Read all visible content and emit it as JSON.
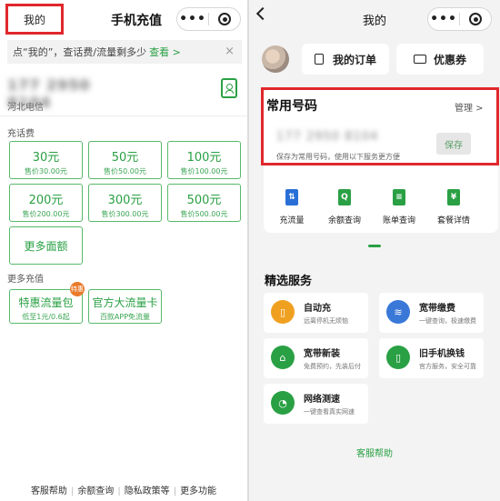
{
  "left": {
    "mine_label": "我的",
    "title": "手机充值",
    "capsule_dots": "•••",
    "tip": {
      "text": "点“我的”，查话费/流量剩多少",
      "link": "查看 >",
      "close": "×"
    },
    "phone": "177 2950 8104",
    "carrier": "河北电信",
    "section_recharge": "充话费",
    "amounts": [
      {
        "value": "30元",
        "price": "售价30.00元"
      },
      {
        "value": "50元",
        "price": "售价50.00元"
      },
      {
        "value": "100元",
        "price": "售价100.00元"
      },
      {
        "value": "200元",
        "price": "售价200.00元"
      },
      {
        "value": "300元",
        "price": "售价300.00元"
      },
      {
        "value": "500元",
        "price": "售价500.00元"
      }
    ],
    "more_amounts": "更多面额",
    "section_more": "更多充值",
    "packages": [
      {
        "title": "特惠流量包",
        "sub": "低至1元/0.6起"
      },
      {
        "title": "官方大流量卡",
        "sub": "百款APP免流量"
      }
    ],
    "badge": "特惠",
    "footer": [
      "客服帮助",
      "余额查询",
      "隐私政策等",
      "更多功能"
    ],
    "footer_sep": "|"
  },
  "right": {
    "title": "我的",
    "capsule_dots": "•••",
    "orders_label": "我的订单",
    "coupons_label": "优惠券",
    "section_common": "常用号码",
    "manage": "管理 >",
    "phone": "177 2950 8104",
    "hint": "保存为常用号码，使用以下服务更方便",
    "save": "保存",
    "services": [
      {
        "label": "充流量",
        "icon": "flow-icon",
        "color": "#2a6fd6",
        "glyph": "⇅"
      },
      {
        "label": "余额查询",
        "icon": "balance-query-icon",
        "color": "#2aa044",
        "glyph": "Q"
      },
      {
        "label": "账单查询",
        "icon": "bill-icon",
        "color": "#2aa044",
        "glyph": "≡"
      },
      {
        "label": "套餐详情",
        "icon": "plan-detail-icon",
        "color": "#2aa044",
        "glyph": "¥"
      }
    ],
    "section_featured": "精选服务",
    "tiles": [
      {
        "title": "自动充",
        "sub": "远离停机无烦恼",
        "icon": "auto-recharge-icon",
        "color": "#f0a020",
        "glyph": "▯"
      },
      {
        "title": "宽带缴费",
        "sub": "一键查询，极速缴费",
        "icon": "broadband-pay-icon",
        "color": "#3a78d8",
        "glyph": "≋"
      },
      {
        "title": "宽带新装",
        "sub": "免费预约，先装后付",
        "icon": "broadband-install-icon",
        "color": "#2aa044",
        "glyph": "⌂"
      },
      {
        "title": "旧手机换钱",
        "sub": "官方服务，安全可靠",
        "icon": "trade-in-icon",
        "color": "#2aa044",
        "glyph": "▯"
      },
      {
        "title": "网络测速",
        "sub": "一键查看真实网速",
        "icon": "speed-test-icon",
        "color": "#2aa044",
        "glyph": "◔"
      }
    ],
    "help": "客服帮助"
  }
}
